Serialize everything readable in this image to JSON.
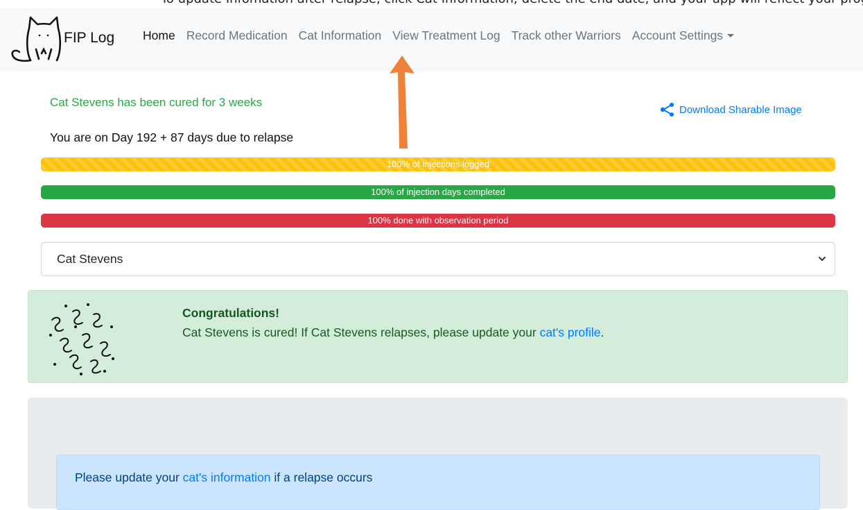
{
  "caption": "To update Infomation after relapse, click Cat Information; delete the end date, and your app will reflect your progress. A relapse page will appear only if a page",
  "navbar": {
    "brand": "FIP Log",
    "items": [
      {
        "label": "Home",
        "active": true
      },
      {
        "label": "Record Medication"
      },
      {
        "label": "Cat Information"
      },
      {
        "label": "View Treatment Log"
      },
      {
        "label": "Track other Warriors"
      },
      {
        "label": "Account Settings",
        "dropdown": true
      }
    ]
  },
  "status": {
    "cured_text": "Cat Stevens has been cured for 3 weeks",
    "share_label": "Download Sharable Image",
    "day_text": "You are on Day 192 + 87 days due to relapse"
  },
  "progress": [
    {
      "label": "100% of injections logged",
      "value": 1.0,
      "color": "#ffc107"
    },
    {
      "label": "100% of injection days completed",
      "value": 1.0,
      "color": "#28a745"
    },
    {
      "label": "100% done with observation period",
      "value": 1.0,
      "color": "#dc3545"
    }
  ],
  "cat_select": {
    "selected": "Cat Stevens"
  },
  "congrats": {
    "title": "Congratulations!",
    "body_prefix": "Cat Stevens is cured! If Cat Stevens relapses, please update your ",
    "link": "cat's profile",
    "body_suffix": "."
  },
  "relapse_notice": {
    "prefix": "Please update your ",
    "link": "cat's information",
    "suffix": " if a relapse occurs"
  },
  "colors": {
    "accent": "#007bff",
    "success": "#28a745",
    "warning": "#ffc107",
    "danger": "#dc3545",
    "annotation_arrow": "#f0813b"
  }
}
